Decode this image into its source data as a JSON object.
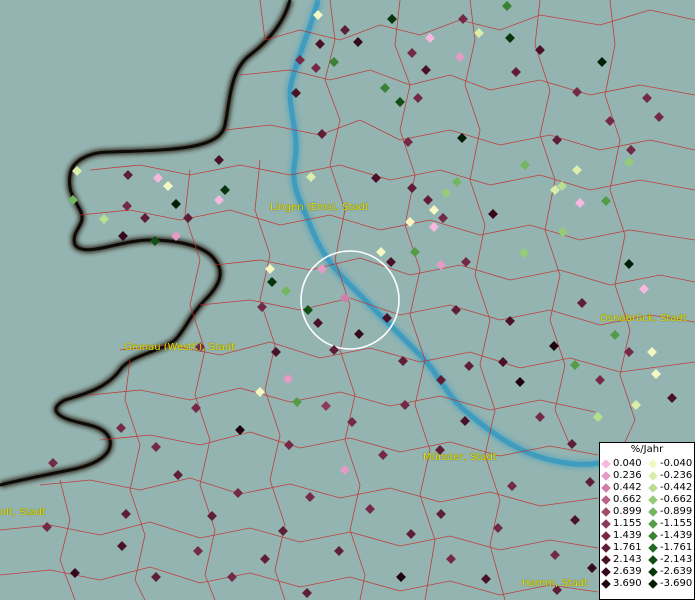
{
  "map": {
    "cities": [
      {
        "id": "lingen",
        "name": "Lingen (Ems), Stadt"
      },
      {
        "id": "gronau",
        "name": "Gronau (Westf.), Stadt"
      },
      {
        "id": "osnabrueck",
        "name": "Osnabrück, Stadt"
      },
      {
        "id": "muenster",
        "name": "Münster, Stadt"
      },
      {
        "id": "bocholt",
        "name": "olt, Stadt"
      },
      {
        "id": "hamm",
        "name": "Hamm, Stadt"
      }
    ]
  },
  "legend": {
    "title": "%/Jahr",
    "positive": [
      {
        "label": "0.040",
        "color": "#f7b8df"
      },
      {
        "label": "0.236",
        "color": "#e59bc5"
      },
      {
        "label": "0.442",
        "color": "#cf7fa7"
      },
      {
        "label": "0.662",
        "color": "#b8638a"
      },
      {
        "label": "0.899",
        "color": "#a04c70"
      },
      {
        "label": "1.155",
        "color": "#8a3a5a"
      },
      {
        "label": "1.439",
        "color": "#742a47"
      },
      {
        "label": "1.761",
        "color": "#5e1e37"
      },
      {
        "label": "2.143",
        "color": "#4a1228"
      },
      {
        "label": "2.639",
        "color": "#360a1c"
      },
      {
        "label": "3.690",
        "color": "#1e040e"
      }
    ],
    "negative": [
      {
        "label": "-0.040",
        "color": "#f4f7c2"
      },
      {
        "label": "-0.236",
        "color": "#d8eeaa"
      },
      {
        "label": "-0.442",
        "color": "#b7df8f"
      },
      {
        "label": "-0.662",
        "color": "#96cc78"
      },
      {
        "label": "-0.899",
        "color": "#74b660"
      },
      {
        "label": "-1.155",
        "color": "#549c48"
      },
      {
        "label": "-1.439",
        "color": "#3a8234"
      },
      {
        "label": "-1.761",
        "color": "#246824"
      },
      {
        "label": "-2.143",
        "color": "#124e16"
      },
      {
        "label": "-2.639",
        "color": "#07360c"
      },
      {
        "label": "-3.690",
        "color": "#021e05"
      }
    ]
  }
}
